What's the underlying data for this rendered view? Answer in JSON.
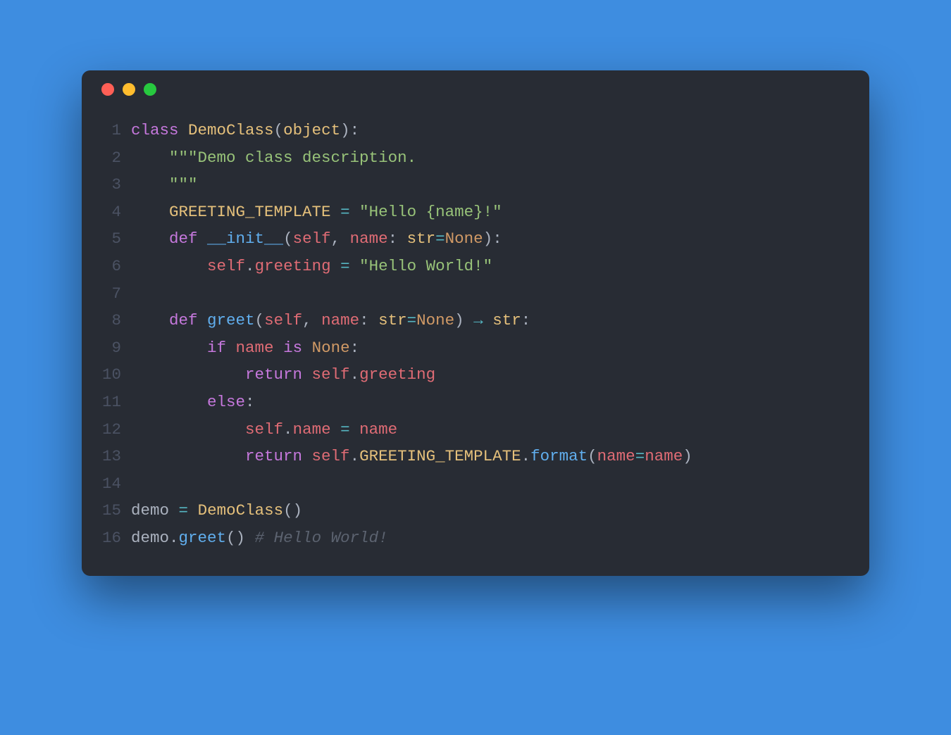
{
  "window": {
    "traffic_lights": [
      "red",
      "yellow",
      "green"
    ]
  },
  "colors": {
    "background_page": "#3e8de0",
    "background_window": "#282c34",
    "line_number": "#4b5263",
    "default_text": "#abb2bf",
    "keyword": "#c678dd",
    "function": "#61afef",
    "class": "#e5c07b",
    "builtin": "#e5c07b",
    "constant": "#d19a66",
    "self": "#e06c75",
    "string": "#98c379",
    "operator": "#56b6c2",
    "comment": "#5c6370"
  },
  "code": {
    "language": "python",
    "line_count": 16,
    "line_numbers": [
      "1",
      "2",
      "3",
      "4",
      "5",
      "6",
      "7",
      "8",
      "9",
      "10",
      "11",
      "12",
      "13",
      "14",
      "15",
      "16"
    ],
    "plain_lines": [
      "class DemoClass(object):",
      "    \"\"\"Demo class description.",
      "    \"\"\"",
      "    GREETING_TEMPLATE = \"Hello {name}!\"",
      "    def __init__(self, name: str=None):",
      "        self.greeting = \"Hello World!\"",
      "",
      "    def greet(self, name: str=None) → str:",
      "        if name is None:",
      "            return self.greeting",
      "        else:",
      "            self.name = name",
      "            return self.GREETING_TEMPLATE.format(name=name)",
      "",
      "demo = DemoClass()",
      "demo.greet() # Hello World!"
    ],
    "lines": [
      [
        {
          "t": "class ",
          "c": "kw"
        },
        {
          "t": "DemoClass",
          "c": "cls"
        },
        {
          "t": "(",
          "c": "pun"
        },
        {
          "t": "object",
          "c": "bi"
        },
        {
          "t": "):",
          "c": "pun"
        }
      ],
      [
        {
          "t": "    ",
          "c": "var"
        },
        {
          "t": "\"\"\"Demo class description.",
          "c": "str"
        }
      ],
      [
        {
          "t": "    ",
          "c": "var"
        },
        {
          "t": "\"\"\"",
          "c": "str"
        }
      ],
      [
        {
          "t": "    ",
          "c": "var"
        },
        {
          "t": "GREETING_TEMPLATE",
          "c": "cls"
        },
        {
          "t": " ",
          "c": "var"
        },
        {
          "t": "=",
          "c": "op"
        },
        {
          "t": " ",
          "c": "var"
        },
        {
          "t": "\"Hello {name}!\"",
          "c": "str"
        }
      ],
      [
        {
          "t": "    ",
          "c": "var"
        },
        {
          "t": "def ",
          "c": "kw"
        },
        {
          "t": "__init__",
          "c": "fn"
        },
        {
          "t": "(",
          "c": "pun"
        },
        {
          "t": "self",
          "c": "self"
        },
        {
          "t": ", ",
          "c": "pun"
        },
        {
          "t": "name",
          "c": "attr"
        },
        {
          "t": ": ",
          "c": "pun"
        },
        {
          "t": "str",
          "c": "bi"
        },
        {
          "t": "=",
          "c": "op"
        },
        {
          "t": "None",
          "c": "cnst"
        },
        {
          "t": "):",
          "c": "pun"
        }
      ],
      [
        {
          "t": "        ",
          "c": "var"
        },
        {
          "t": "self",
          "c": "self"
        },
        {
          "t": ".",
          "c": "pun"
        },
        {
          "t": "greeting",
          "c": "attr"
        },
        {
          "t": " ",
          "c": "var"
        },
        {
          "t": "=",
          "c": "op"
        },
        {
          "t": " ",
          "c": "var"
        },
        {
          "t": "\"Hello World!\"",
          "c": "str"
        }
      ],
      [
        {
          "t": "",
          "c": "var"
        }
      ],
      [
        {
          "t": "    ",
          "c": "var"
        },
        {
          "t": "def ",
          "c": "kw"
        },
        {
          "t": "greet",
          "c": "fn"
        },
        {
          "t": "(",
          "c": "pun"
        },
        {
          "t": "self",
          "c": "self"
        },
        {
          "t": ", ",
          "c": "pun"
        },
        {
          "t": "name",
          "c": "attr"
        },
        {
          "t": ": ",
          "c": "pun"
        },
        {
          "t": "str",
          "c": "bi"
        },
        {
          "t": "=",
          "c": "op"
        },
        {
          "t": "None",
          "c": "cnst"
        },
        {
          "t": ") ",
          "c": "pun"
        },
        {
          "t": "→",
          "c": "op"
        },
        {
          "t": " ",
          "c": "var"
        },
        {
          "t": "str",
          "c": "bi"
        },
        {
          "t": ":",
          "c": "pun"
        }
      ],
      [
        {
          "t": "        ",
          "c": "var"
        },
        {
          "t": "if ",
          "c": "kw"
        },
        {
          "t": "name",
          "c": "attr"
        },
        {
          "t": " ",
          "c": "var"
        },
        {
          "t": "is ",
          "c": "kw"
        },
        {
          "t": "None",
          "c": "cnst"
        },
        {
          "t": ":",
          "c": "pun"
        }
      ],
      [
        {
          "t": "            ",
          "c": "var"
        },
        {
          "t": "return ",
          "c": "kw"
        },
        {
          "t": "self",
          "c": "self"
        },
        {
          "t": ".",
          "c": "pun"
        },
        {
          "t": "greeting",
          "c": "attr"
        }
      ],
      [
        {
          "t": "        ",
          "c": "var"
        },
        {
          "t": "else",
          "c": "kw"
        },
        {
          "t": ":",
          "c": "pun"
        }
      ],
      [
        {
          "t": "            ",
          "c": "var"
        },
        {
          "t": "self",
          "c": "self"
        },
        {
          "t": ".",
          "c": "pun"
        },
        {
          "t": "name",
          "c": "attr"
        },
        {
          "t": " ",
          "c": "var"
        },
        {
          "t": "=",
          "c": "op"
        },
        {
          "t": " ",
          "c": "var"
        },
        {
          "t": "name",
          "c": "attr"
        }
      ],
      [
        {
          "t": "            ",
          "c": "var"
        },
        {
          "t": "return ",
          "c": "kw"
        },
        {
          "t": "self",
          "c": "self"
        },
        {
          "t": ".",
          "c": "pun"
        },
        {
          "t": "GREETING_TEMPLATE",
          "c": "cls"
        },
        {
          "t": ".",
          "c": "pun"
        },
        {
          "t": "format",
          "c": "fn"
        },
        {
          "t": "(",
          "c": "pun"
        },
        {
          "t": "name",
          "c": "attr"
        },
        {
          "t": "=",
          "c": "op"
        },
        {
          "t": "name",
          "c": "attr"
        },
        {
          "t": ")",
          "c": "pun"
        }
      ],
      [
        {
          "t": "",
          "c": "var"
        }
      ],
      [
        {
          "t": "demo",
          "c": "var"
        },
        {
          "t": " ",
          "c": "var"
        },
        {
          "t": "=",
          "c": "op"
        },
        {
          "t": " ",
          "c": "var"
        },
        {
          "t": "DemoClass",
          "c": "cls"
        },
        {
          "t": "()",
          "c": "pun"
        }
      ],
      [
        {
          "t": "demo",
          "c": "var"
        },
        {
          "t": ".",
          "c": "pun"
        },
        {
          "t": "greet",
          "c": "fn"
        },
        {
          "t": "()",
          "c": "pun"
        },
        {
          "t": " ",
          "c": "var"
        },
        {
          "t": "# Hello World!",
          "c": "com"
        }
      ]
    ]
  }
}
